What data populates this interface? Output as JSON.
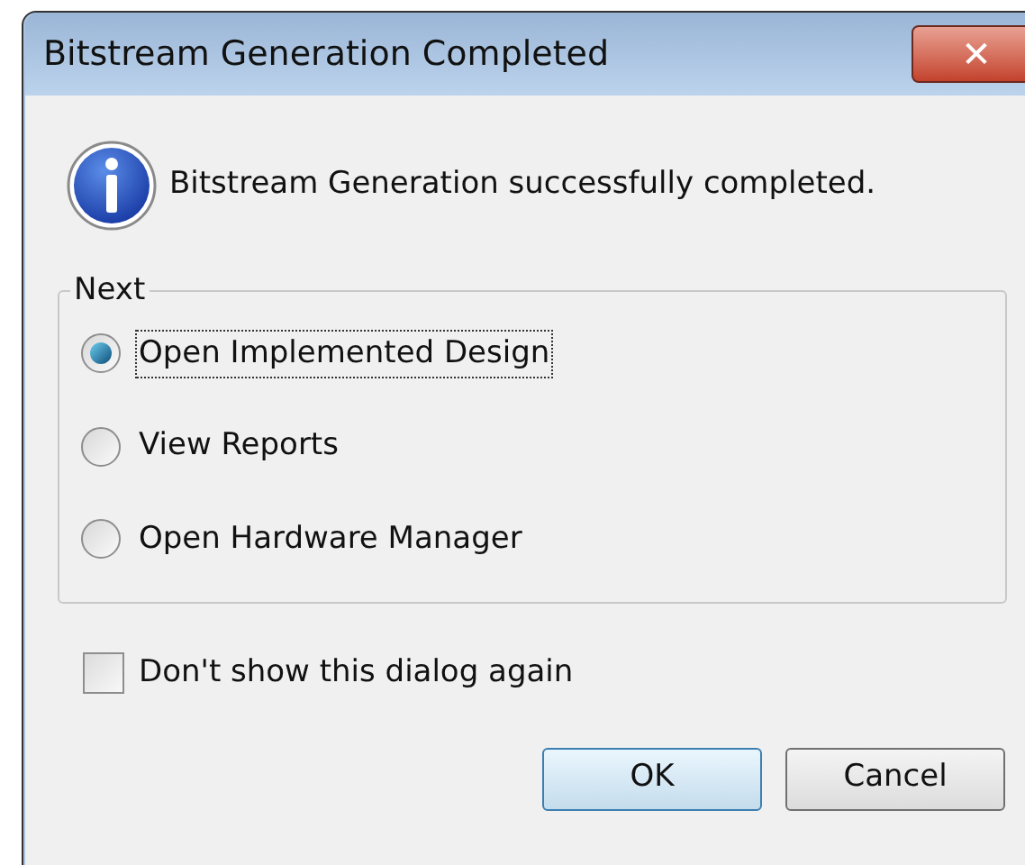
{
  "window": {
    "title": "Bitstream Generation Completed",
    "close": "✕"
  },
  "message": "Bitstream Generation successfully completed.",
  "group": {
    "title": "Next",
    "options": [
      {
        "label": "Open Implemented Design",
        "selected": true,
        "focused": true
      },
      {
        "label": "View Reports",
        "selected": false,
        "focused": false
      },
      {
        "label": "Open Hardware Manager",
        "selected": false,
        "focused": false
      }
    ]
  },
  "checkbox": {
    "label": "Don't show this dialog again",
    "checked": false
  },
  "buttons": [
    {
      "label": "OK",
      "default": true
    },
    {
      "label": "Cancel",
      "default": false
    }
  ]
}
